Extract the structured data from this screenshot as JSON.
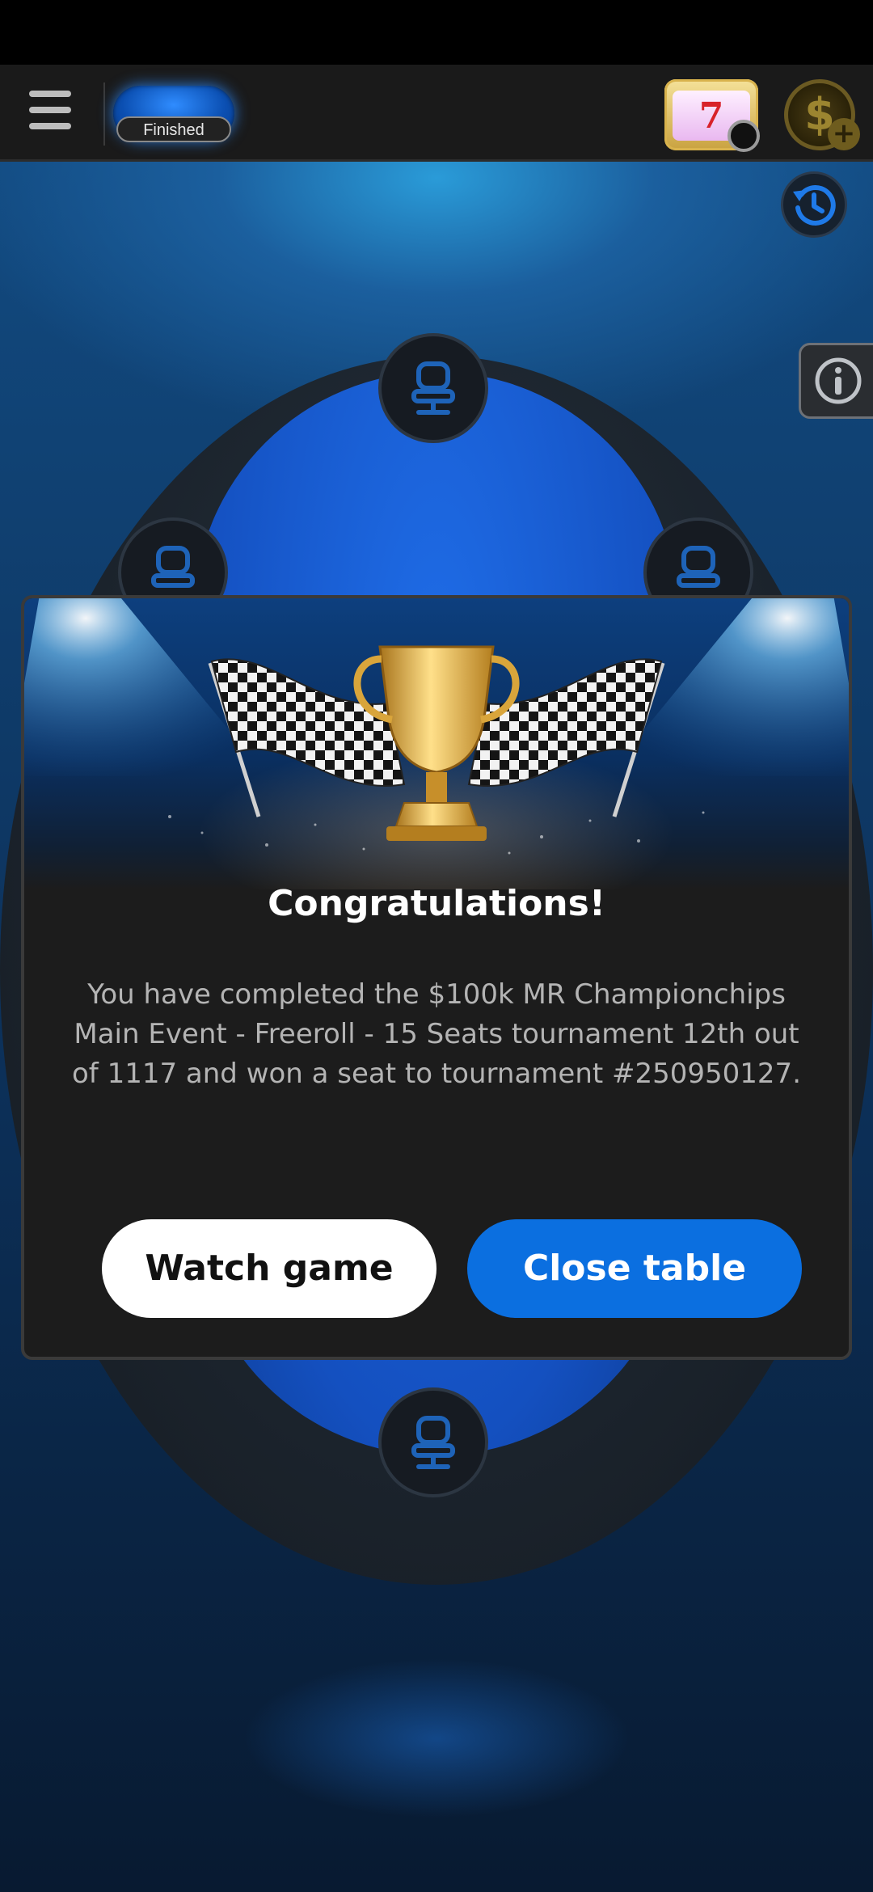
{
  "header": {
    "status_label": "Finished",
    "menu_icon": "hamburger-menu-icon",
    "slots_icon": "slot-machine-icon",
    "slots_symbol": "7",
    "cashier_icon": "dollar-coin-icon",
    "cashier_symbol": "$",
    "cashier_add_symbol": "+"
  },
  "table": {
    "history_icon": "hand-history-icon",
    "info_icon": "info-icon",
    "seat_icon": "chair-icon",
    "felt_color": "#1450c0"
  },
  "dialog": {
    "title": "Congratulations!",
    "message": "You have completed the $100k MR Championchips Main Event - Freeroll - 15 Seats tournament 12th out of 1117 and won a seat to tournament #250950127.",
    "banner_icons": [
      "trophy-icon",
      "checkered-flag-icon"
    ],
    "watch_label": "Watch game",
    "close_label": "Close table"
  },
  "colors": {
    "accent_blue": "#0b6fe0",
    "dialog_bg": "#1c1c1c",
    "trophy_gold": "#e8b23a"
  }
}
